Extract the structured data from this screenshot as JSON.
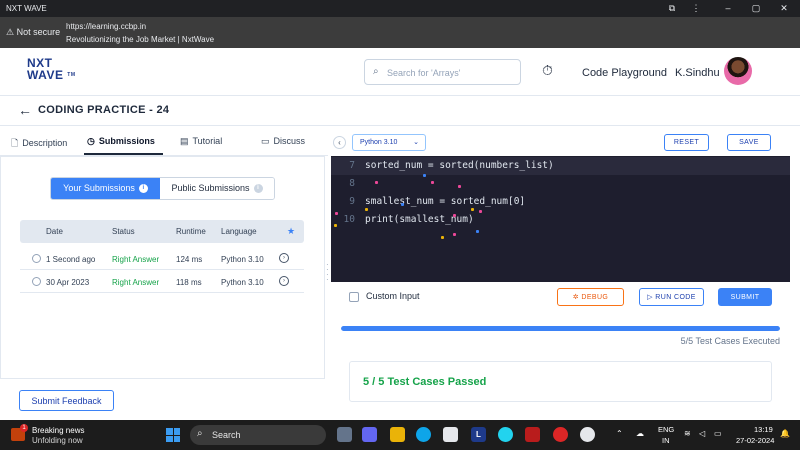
{
  "browser": {
    "window_title": "NXT WAVE",
    "security": "Not secure",
    "url": "https://learning.ccbp.in",
    "page_title": "Revolutionizing the Job Market | NxtWave"
  },
  "header": {
    "logo_line1": "NXT",
    "logo_line2": "WAVE",
    "logo_tm": "TM",
    "search_placeholder": "Search for 'Arrays'",
    "code_playground": "Code Playground",
    "user_name": "K.Sindhu"
  },
  "page": {
    "title": "CODING PRACTICE - 24"
  },
  "tabs": [
    {
      "label": "Description",
      "icon": "document-icon"
    },
    {
      "label": "Submissions",
      "icon": "clock-icon"
    },
    {
      "label": "Tutorial",
      "icon": "book-icon"
    },
    {
      "label": "Discuss",
      "icon": "chat-icon"
    }
  ],
  "submissions": {
    "your_label": "Your Submissions",
    "public_label": "Public Submissions",
    "columns": [
      "Date",
      "Status",
      "Runtime",
      "Language"
    ],
    "rows": [
      {
        "date": "1 Second ago",
        "status": "Right Answer",
        "runtime": "124 ms",
        "language": "Python 3.10"
      },
      {
        "date": "30 Apr 2023",
        "status": "Right Answer",
        "runtime": "118 ms",
        "language": "Python 3.10"
      }
    ]
  },
  "feedback_label": "Submit Feedback",
  "editor": {
    "language": "Python 3.10",
    "reset_label": "RESET",
    "save_label": "SAVE",
    "lines": [
      {
        "num": "7",
        "code": "sorted_num = sorted(numbers_list)"
      },
      {
        "num": "8",
        "code": ""
      },
      {
        "num": "9",
        "code": "smallest_num = sorted_num[0]"
      },
      {
        "num": "10",
        "code": "print(smallest_num)"
      }
    ]
  },
  "actions": {
    "custom_input": "Custom Input",
    "debug_label": "DEBUG",
    "run_label": "RUN CODE",
    "submit_label": "SUBMIT"
  },
  "results": {
    "progress_fraction": 1.0,
    "executed_text": "5/5 Test Cases Executed",
    "passed_text": "5 / 5 Test Cases Passed"
  },
  "taskbar": {
    "news_title": "Breaking news",
    "news_sub": "Unfolding now",
    "news_badge": "1",
    "search_label": "Search",
    "lang_line1": "ENG",
    "lang_line2": "IN",
    "time": "13:19",
    "date": "27-02-2024"
  },
  "colors": {
    "accent": "#3b82f6",
    "success": "#16a34a",
    "debug": "#ea580c",
    "editor_bg": "#1e1e2e"
  }
}
